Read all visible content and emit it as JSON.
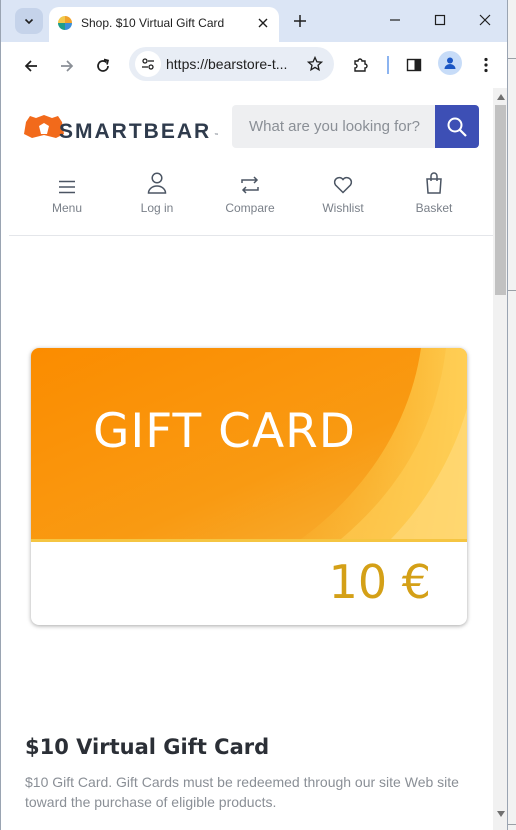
{
  "browser": {
    "tab_title": "Shop. $10 Virtual Gift Card",
    "url": "https://bearstore-t...",
    "accent_color": "#dbe5f5"
  },
  "site": {
    "brand": "SMARTBEAR",
    "brand_tm": "™",
    "search_placeholder": "What are you looking for?",
    "brand_color": "#3d4fb5",
    "nav": [
      {
        "label": "Menu",
        "icon": "hamburger-icon"
      },
      {
        "label": "Log in",
        "icon": "user-icon"
      },
      {
        "label": "Compare",
        "icon": "compare-icon"
      },
      {
        "label": "Wishlist",
        "icon": "heart-icon"
      },
      {
        "label": "Basket",
        "icon": "basket-icon"
      }
    ]
  },
  "product": {
    "card_title": "GIFT CARD",
    "card_amount": "10 €",
    "title": "$10 Virtual Gift Card",
    "description": "$10 Gift Card. Gift Cards must be redeemed through our site Web site toward the purchase of eligible products.",
    "card_orange": "#f79a10",
    "card_gold": "#d4a017"
  }
}
